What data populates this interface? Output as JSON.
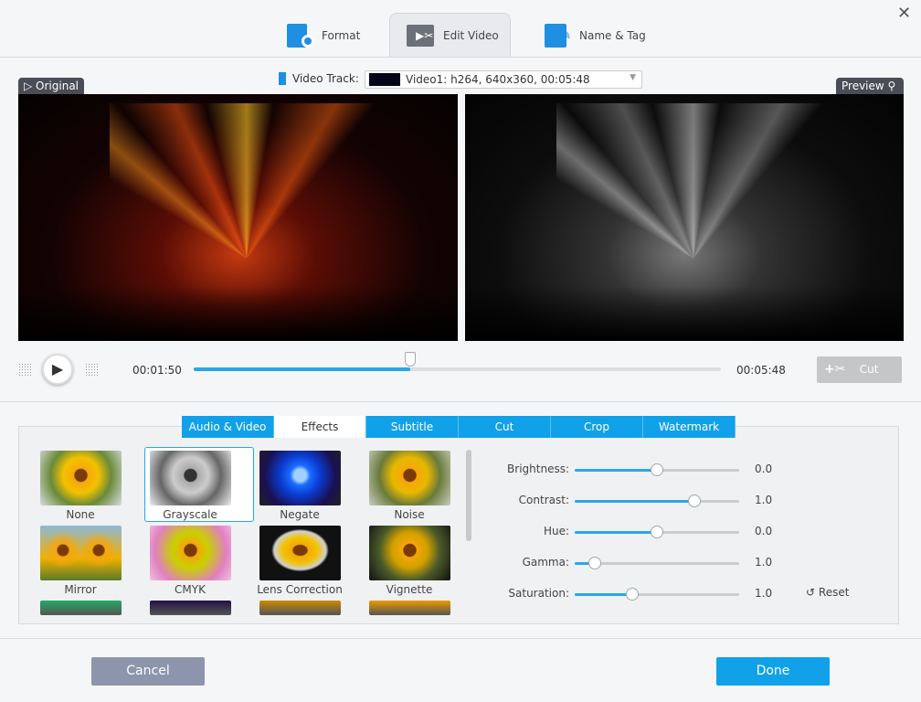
{
  "window": {
    "close_icon": "close-icon"
  },
  "top_tabs": [
    {
      "label": "Format",
      "icon": "format-settings-icon"
    },
    {
      "label": "Edit Video",
      "icon": "video-scissors-icon",
      "active": true
    },
    {
      "label": "Name & Tag",
      "icon": "edit-document-icon"
    }
  ],
  "video_track": {
    "label": "Video Track:",
    "value": "Video1: h264, 640x360, 00:05:48"
  },
  "original_label": "Original",
  "preview_label": "Preview",
  "player": {
    "current_time": "00:01:50",
    "total_time": "00:05:48",
    "progress_fraction": 0.41,
    "cut_label": "Cut"
  },
  "edit_tabs": [
    "Audio & Video",
    "Effects",
    "Subtitle",
    "Cut",
    "Crop",
    "Watermark"
  ],
  "active_edit_tab": "Effects",
  "effects": [
    "None",
    "Grayscale",
    "Negate",
    "Noise",
    "Mirror",
    "CMYK",
    "Lens Correction",
    "Vignette"
  ],
  "selected_effect": "Grayscale",
  "adjustments": [
    {
      "label": "Brightness:",
      "value": "0.0",
      "level": 0.5
    },
    {
      "label": "Contrast:",
      "value": "1.0",
      "level": 0.73
    },
    {
      "label": "Hue:",
      "value": "0.0",
      "level": 0.5
    },
    {
      "label": "Gamma:",
      "value": "1.0",
      "level": 0.12
    },
    {
      "label": "Saturation:",
      "value": "1.0",
      "level": 0.35
    }
  ],
  "reset_label": "Reset",
  "footer": {
    "cancel": "Cancel",
    "done": "Done"
  },
  "colors": {
    "accent": "#11a1e8",
    "cancel": "#8c95ac"
  }
}
